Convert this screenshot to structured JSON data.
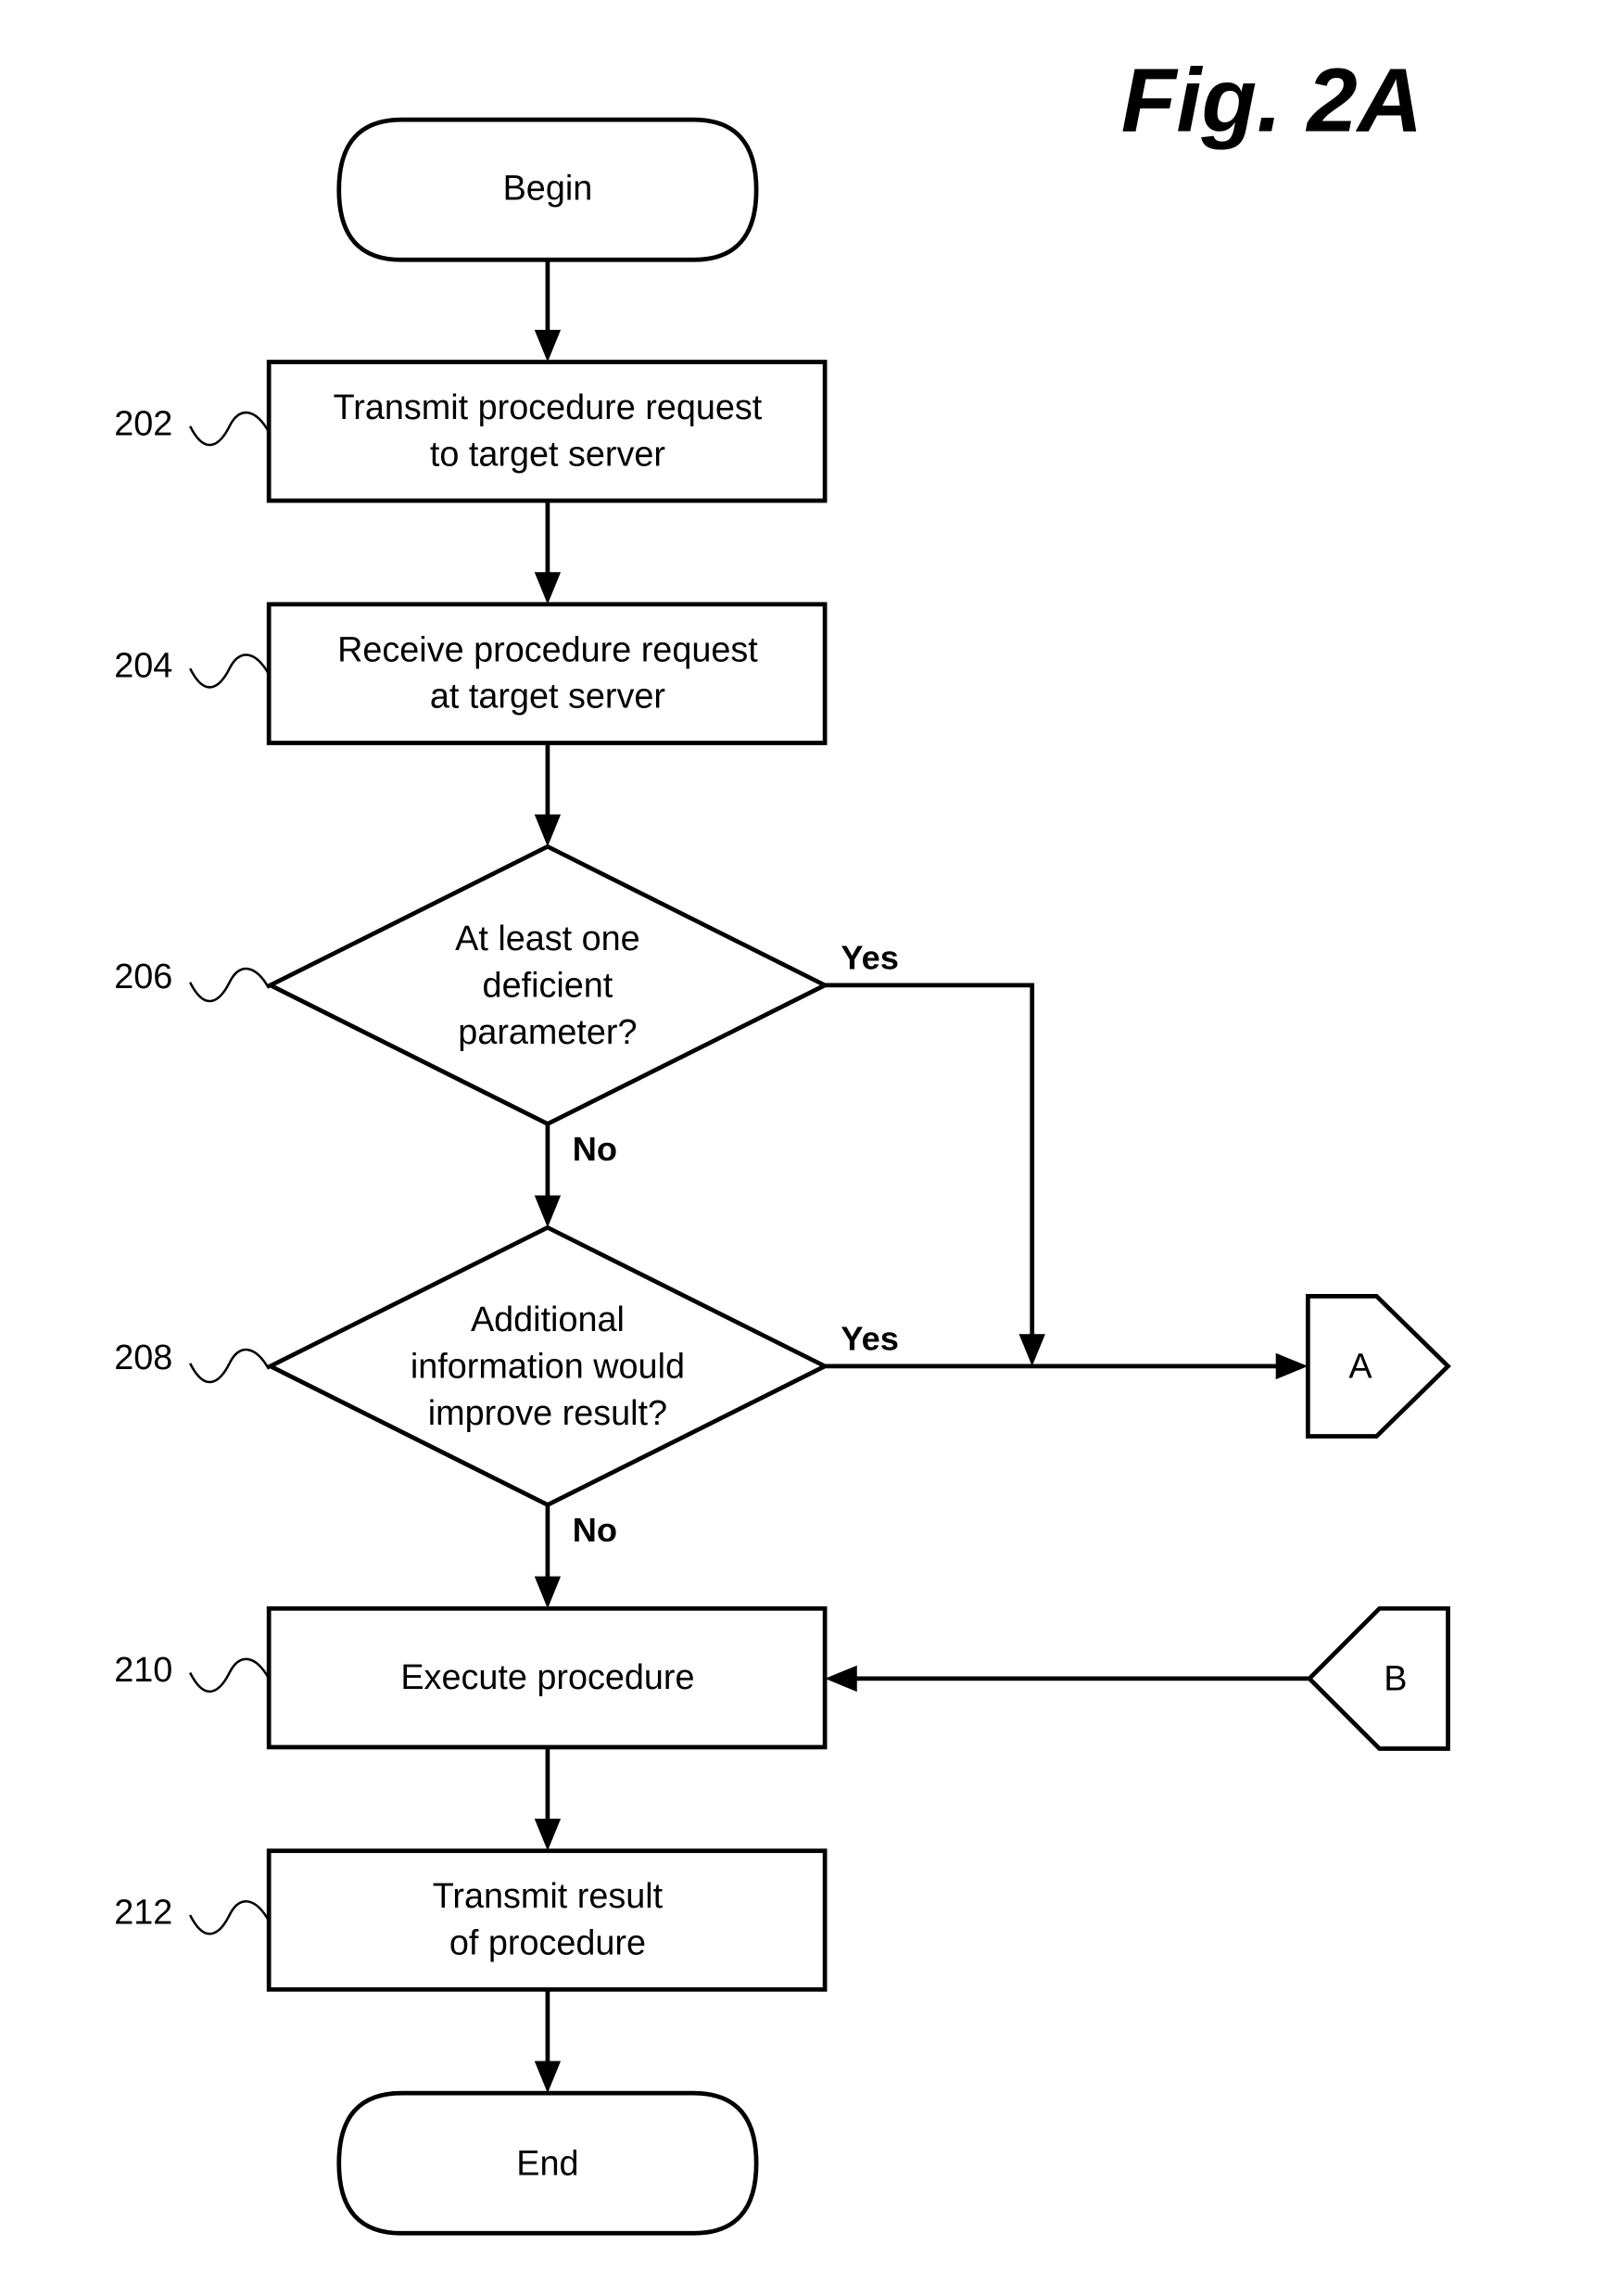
{
  "figure": {
    "title": "Fig. 2A"
  },
  "flowchart": {
    "begin": {
      "label": "Begin"
    },
    "end": {
      "label": "End"
    },
    "steps": [
      {
        "ref": "202",
        "lines": [
          "Transmit procedure request",
          "to target server"
        ]
      },
      {
        "ref": "204",
        "lines": [
          "Receive procedure request",
          "at target server"
        ]
      },
      {
        "ref": "206",
        "lines": [
          "At least one",
          "deficient",
          "parameter?"
        ],
        "type": "decision",
        "yes_label": "Yes",
        "no_label": "No"
      },
      {
        "ref": "208",
        "lines": [
          "Additional",
          "information would",
          "improve result?"
        ],
        "type": "decision",
        "yes_label": "Yes",
        "no_label": "No"
      },
      {
        "ref": "210",
        "lines": [
          "Execute procedure"
        ]
      },
      {
        "ref": "212",
        "lines": [
          "Transmit result",
          "of procedure"
        ]
      }
    ],
    "connectors": {
      "out": {
        "label": "A"
      },
      "in": {
        "label": "B"
      }
    }
  }
}
